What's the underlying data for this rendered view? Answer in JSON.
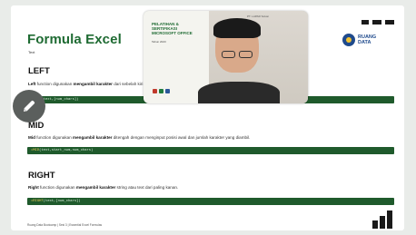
{
  "slide": {
    "title": "Formula Excel",
    "subtitle": "Text",
    "brand_text": "RUANG\nDATA",
    "sections": [
      {
        "heading": "LEFT",
        "desc_parts": [
          "Left",
          " function digunakan ",
          "mengambil karakter",
          " dari sebelah kiri ..."
        ],
        "code_fn": "=LEFT",
        "code_args": "(text,[num_chars])"
      },
      {
        "heading": "MID",
        "desc_parts": [
          "Mid",
          " function digunakan ",
          "mengambil karakter",
          " ditengah dengan menginput posisi awal dan jumlah karakter yang diambil."
        ],
        "code_fn": "=MID",
        "code_args": "(text,start_num,num_chars)"
      },
      {
        "heading": "RIGHT",
        "desc_parts": [
          "Right",
          " function digunakan ",
          "mengambil karakter",
          " string atau text dari paling kanan."
        ],
        "code_fn": "=RIGHT",
        "code_args": "(text,[num_chars])"
      }
    ],
    "footer": "Ruang Data Bootcamp  |  Sesi 3  |  Essential Excel Formulas"
  },
  "video": {
    "panel_title": "PELATIHAN &\nSERTIFIKASI\nMICROSOFT OFFICE",
    "panel_year": "Tahun 2023",
    "wall_logo": "PT. LAPAR Solusi"
  },
  "colors": {
    "accent_green": "#1f6b33",
    "code_bg": "#1f5a2c",
    "brand_blue": "#1f4a8c"
  },
  "icons": {
    "edit": "pencil-icon",
    "brand": "ruang-data-logo"
  }
}
